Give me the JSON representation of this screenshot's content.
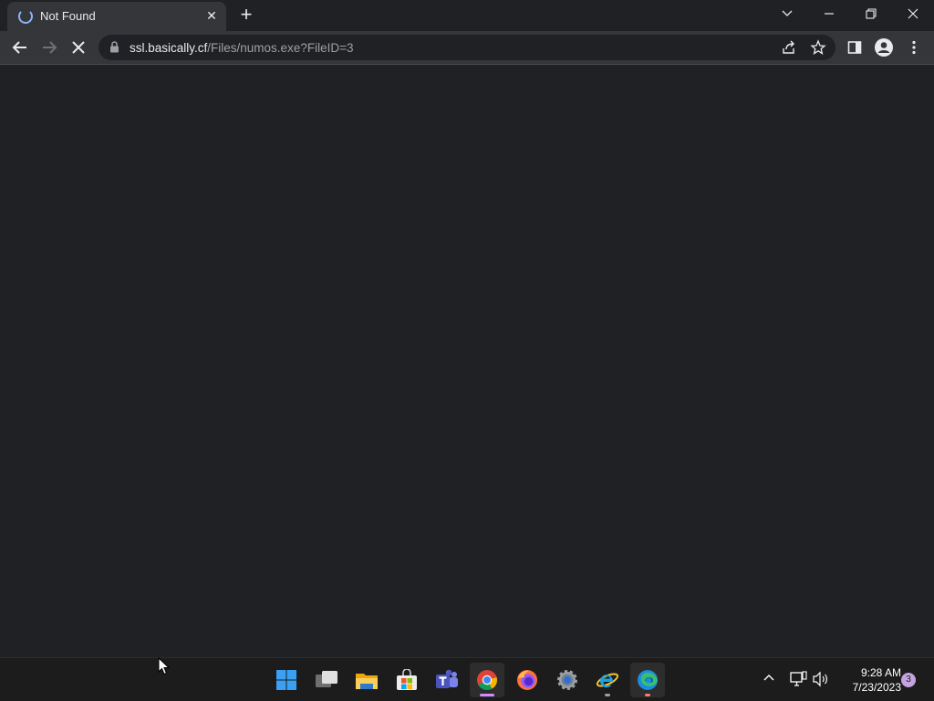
{
  "tab": {
    "title": "Not Found",
    "close": "✕"
  },
  "newtab": "+",
  "omnibox": {
    "host": "ssl.basically.cf",
    "path": "/Files/numos.exe?FileID=3"
  },
  "clock": {
    "time": "9:28 AM",
    "date": "7/23/2023"
  },
  "notification_count": "3",
  "colors": {
    "accent": "#8ab4f8",
    "tab_bg": "#35363a",
    "page_bg": "#202124",
    "taskbar_bg": "#1c1c1c"
  }
}
